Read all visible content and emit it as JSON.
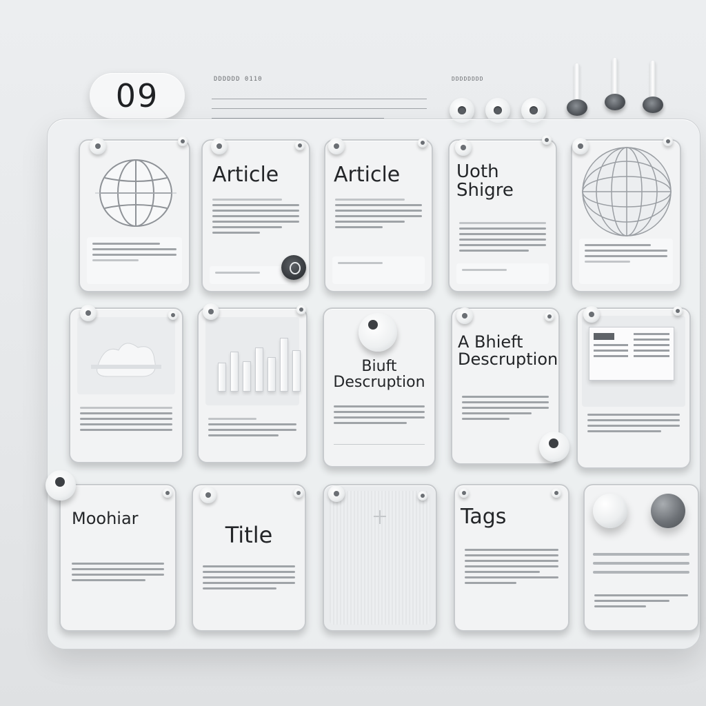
{
  "header": {
    "page_number": "09",
    "caption_left": "DDDDDD 0110",
    "caption_right": "DDDDDDDD"
  },
  "colors": {
    "background": "#e8eaec",
    "card": "#f2f3f4",
    "text": "#232528",
    "accent_dark": "#4f5358"
  },
  "cards": [
    {
      "id": "r1c1",
      "title": "",
      "visual": "globe-icon"
    },
    {
      "id": "r1c2",
      "title": "Article",
      "visual": ""
    },
    {
      "id": "r1c3",
      "title": "Article",
      "visual": ""
    },
    {
      "id": "r1c4",
      "title": "Uoth\nShigre",
      "visual": ""
    },
    {
      "id": "r1c5",
      "title": "",
      "visual": "globe-icon"
    },
    {
      "id": "r2c1",
      "title": "",
      "visual": "image-placeholder"
    },
    {
      "id": "r2c2",
      "title": "",
      "visual": "bar-chart-icon"
    },
    {
      "id": "r2c3",
      "title": "Biuft\nDescruption",
      "visual": "ring-button"
    },
    {
      "id": "r2c4",
      "title": "A Bhieft\nDescruption",
      "visual": ""
    },
    {
      "id": "r2c5",
      "title": "",
      "visual": "document-thumbnail"
    },
    {
      "id": "r3c1",
      "title": "Moohiar",
      "visual": ""
    },
    {
      "id": "r3c2",
      "title": "Title",
      "visual": ""
    },
    {
      "id": "r3c3",
      "title": "",
      "visual": "blank-image"
    },
    {
      "id": "r3c4",
      "title": "Tags",
      "visual": ""
    },
    {
      "id": "r3c5",
      "title": "",
      "visual": "spheres"
    }
  ]
}
